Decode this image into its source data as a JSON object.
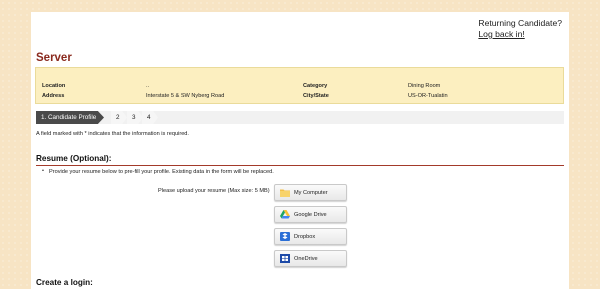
{
  "returning": {
    "question": "Returning Candidate?",
    "link": "Log back in!"
  },
  "job": {
    "title": "Server"
  },
  "info": {
    "location_label": "Location",
    "location_value": "..",
    "address_label": "Address",
    "address_value": "Interstate 5 & SW Nyberg Road",
    "category_label": "Category",
    "category_value": "Dining Room",
    "city_label": "City/State",
    "city_value": "US-OR-Tualatin"
  },
  "steps": {
    "active": "1. Candidate Profile",
    "s2": "2",
    "s3": "3",
    "s4": "4"
  },
  "required_note": "A field marked with * indicates that the information is required.",
  "resume": {
    "title": "Resume (Optional):",
    "instruction": "Provide your resume below to pre-fill your profile. Existing data in the form will be replaced.",
    "upload_label": "Please upload your resume (Max size: 5 MB)",
    "buttons": [
      "My Computer",
      "Google Drive",
      "Dropbox",
      "OneDrive"
    ]
  },
  "login": {
    "title": "Create a login:"
  },
  "colors": {
    "accent": "#8a2a1e",
    "info_bg": "#fcefc0",
    "page_bg": "#f7e4c4"
  },
  "icons": [
    "folder-icon",
    "google-drive-icon",
    "dropbox-icon",
    "onedrive-icon"
  ]
}
